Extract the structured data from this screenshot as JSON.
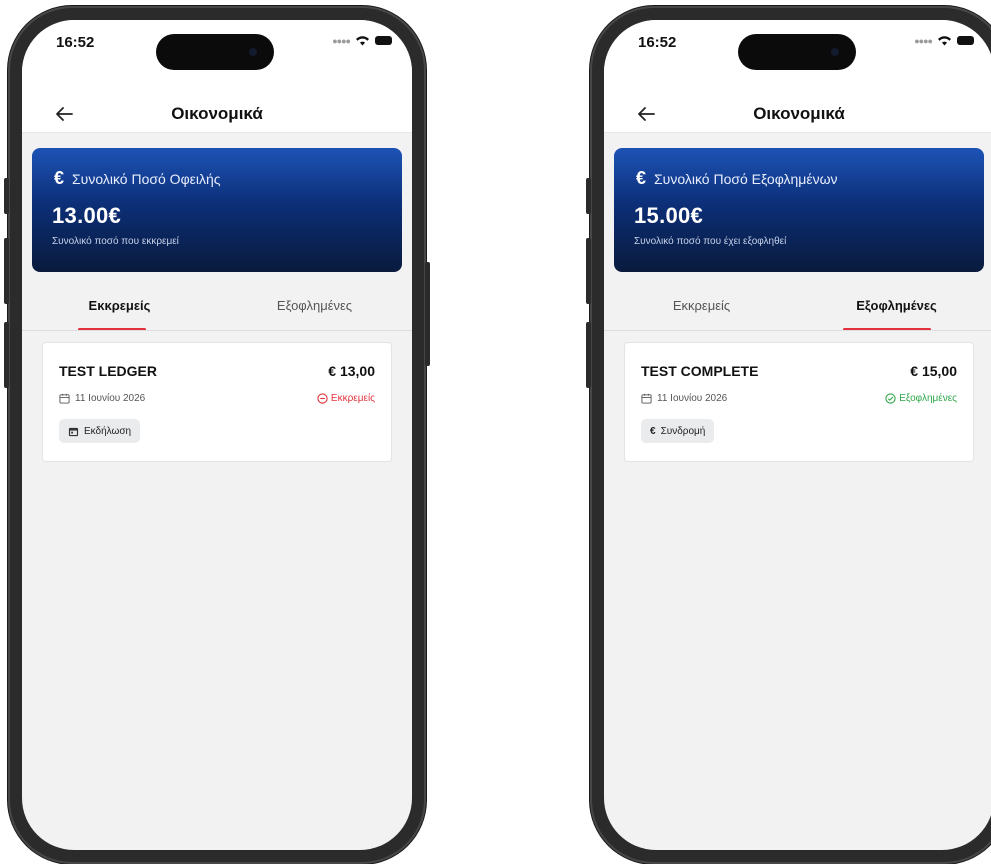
{
  "colors": {
    "accent": "#e3313b",
    "pending_status": "#e3313b",
    "paid_status": "#2ea84a",
    "hero_top": "#1d53b6",
    "hero_bottom": "#091a3c"
  },
  "screens": [
    {
      "status_bar": {
        "time": "16:52"
      },
      "header": {
        "title": "Οικονομικά",
        "back_icon": "arrow-left-icon"
      },
      "summary": {
        "icon": "€",
        "title": "Συνολικό Ποσό Οφειλής",
        "amount": "13.00€",
        "subtitle": "Συνολικό ποσό που εκκρεμεί"
      },
      "tabs": [
        {
          "label": "Εκκρεμείς",
          "active": true
        },
        {
          "label": "Εξοφλημένες",
          "active": false
        }
      ],
      "items": [
        {
          "title": "TEST LEDGER",
          "amount": "€ 13,00",
          "date": "11 Ιουνίου 2026",
          "status": "Εκκρεμείς",
          "status_icon": "minus-circle-icon",
          "chip_icon": "calendar-event-icon",
          "chip_label": "Εκδήλωση"
        }
      ]
    },
    {
      "status_bar": {
        "time": "16:52"
      },
      "header": {
        "title": "Οικονομικά",
        "back_icon": "arrow-left-icon"
      },
      "summary": {
        "icon": "€",
        "title": "Συνολικό Ποσό Εξοφλημένων",
        "amount": "15.00€",
        "subtitle": "Συνολικό ποσό που έχει εξοφληθεί"
      },
      "tabs": [
        {
          "label": "Εκκρεμείς",
          "active": false
        },
        {
          "label": "Εξοφλημένες",
          "active": true
        }
      ],
      "items": [
        {
          "title": "TEST COMPLETE",
          "amount": "€ 15,00",
          "date": "11 Ιουνίου 2026",
          "status": "Εξοφλημένες",
          "status_icon": "check-circle-icon",
          "chip_icon": "euro-icon",
          "chip_label": "Συνδρομή",
          "chip_symbol": "€"
        }
      ]
    }
  ]
}
